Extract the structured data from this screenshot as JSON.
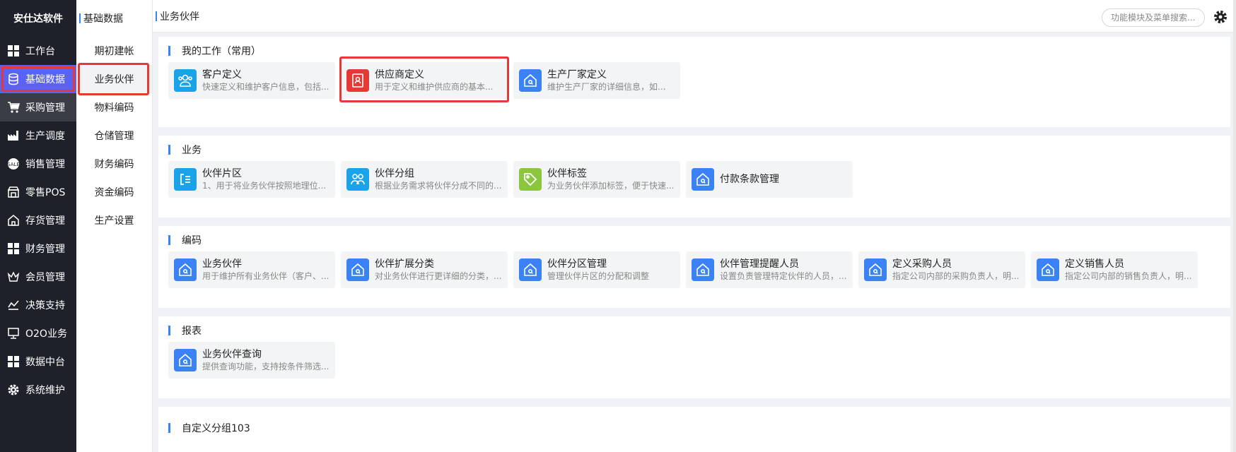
{
  "app": {
    "brand": "安仕达软件"
  },
  "colors": {
    "accent": "#5b63f5",
    "blue": "#3b82f6",
    "red": "#e53935",
    "cyan": "#1aa3e8",
    "green": "#8cc63f"
  },
  "sidebar": {
    "items": [
      {
        "label": "工作台",
        "icon": "grid-icon"
      },
      {
        "label": "基础数据",
        "icon": "database-icon"
      },
      {
        "label": "采购管理",
        "icon": "cart-icon"
      },
      {
        "label": "生产调度",
        "icon": "factory-icon"
      },
      {
        "label": "销售管理",
        "icon": "sale-icon"
      },
      {
        "label": "零售POS",
        "icon": "pos-icon"
      },
      {
        "label": "存货管理",
        "icon": "house-icon"
      },
      {
        "label": "财务管理",
        "icon": "grid-icon"
      },
      {
        "label": "会员管理",
        "icon": "crown-icon"
      },
      {
        "label": "决策支持",
        "icon": "chart-icon"
      },
      {
        "label": "O2O业务",
        "icon": "monitor-icon"
      },
      {
        "label": "数据中台",
        "icon": "grid-icon"
      },
      {
        "label": "系统维护",
        "icon": "gear-icon"
      }
    ]
  },
  "subpanel": {
    "title": "基础数据",
    "items": [
      {
        "label": "期初建帐"
      },
      {
        "label": "业务伙伴"
      },
      {
        "label": "物料编码"
      },
      {
        "label": "仓储管理"
      },
      {
        "label": "财务编码"
      },
      {
        "label": "资金编码"
      },
      {
        "label": "生产设置"
      }
    ]
  },
  "header": {
    "breadcrumb": "业务伙伴",
    "search_placeholder": "功能模块及菜单搜索..."
  },
  "sections": {
    "mywork": {
      "title": "我的工作（常用）",
      "cards": [
        {
          "name": "客户定义",
          "desc": "快速定义和维护客户信息，包括...",
          "icon": "customer-icon"
        },
        {
          "name": "供应商定义",
          "desc": "用于定义和维护供应商的基本...",
          "icon": "supplier-icon"
        },
        {
          "name": "生产厂家定义",
          "desc": "维护生产厂家的详细信息，如...",
          "icon": "home-doc-icon"
        }
      ]
    },
    "biz": {
      "title": "业务",
      "cards": [
        {
          "name": "伙伴片区",
          "desc": "1、用于将业务伙伴按照地理位...",
          "icon": "region-icon"
        },
        {
          "name": "伙伴分组",
          "desc": "根据业务需求将伙伴分成不同的...",
          "icon": "group-icon"
        },
        {
          "name": "伙伴标签",
          "desc": "为业务伙伴添加标签，便于快速...",
          "icon": "tag-icon"
        },
        {
          "name": "付款条款管理",
          "desc": "",
          "icon": "home-doc-icon"
        }
      ]
    },
    "code": {
      "title": "编码",
      "cards": [
        {
          "name": "业务伙伴",
          "desc": "用于维护所有业务伙伴（客户、...",
          "icon": "home-doc-icon"
        },
        {
          "name": "伙伴扩展分类",
          "desc": "对业务伙伴进行更详细的分类，...",
          "icon": "home-doc-icon"
        },
        {
          "name": "伙伴分区管理",
          "desc": "管理伙伴片区的分配和调整",
          "icon": "home-doc-icon"
        },
        {
          "name": "伙伴管理提醒人员",
          "desc": "设置负责管理特定伙伴的人员，...",
          "icon": "home-doc-icon"
        },
        {
          "name": "定义采购人员",
          "desc": "指定公司内部的采购负责人，明...",
          "icon": "home-doc-icon"
        },
        {
          "name": "定义销售人员",
          "desc": "指定公司内部的销售负责人，明...",
          "icon": "home-doc-icon"
        }
      ]
    },
    "report": {
      "title": "报表",
      "cards": [
        {
          "name": "业务伙伴查询",
          "desc": "提供查询功能，支持按条件筛选...",
          "icon": "home-doc-icon"
        }
      ]
    },
    "custom": {
      "title": "自定义分组103"
    }
  }
}
